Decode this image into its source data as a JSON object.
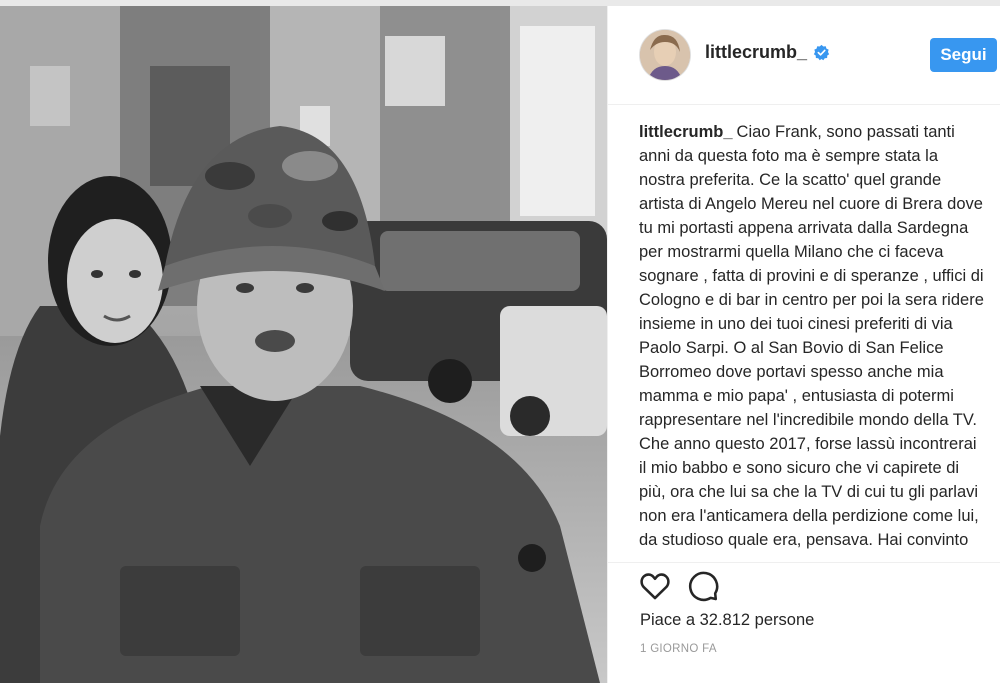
{
  "post": {
    "username": "littlecrumb_",
    "follow_label": "Segui",
    "caption_text": "Ciao Frank, sono passati tanti anni da questa foto ma è sempre stata la nostra preferita. Ce la scatto' quel grande artista di Angelo Mereu nel cuore di Brera dove tu mi portasti appena arrivata dalla Sardegna per mostrarmi quella Milano che ci faceva sognare , fatta di provini e di speranze , uffici di Cologno e di bar in centro per poi la sera ridere insieme in uno dei tuoi cinesi preferiti di via Paolo Sarpi. O al San Bovio di San Felice Borromeo dove portavi spesso anche mia mamma e mio papa' , entusiasta di potermi rappresentare nel l'incredibile mondo della TV. Che anno questo 2017, forse lassù incontrerai il mio babbo e sono sicuro che vi capirete di più, ora che lui sa che la TV di cui tu gli parlavi non era l'anticamera della perdizione come lui, da studioso quale era, pensava. Hai convinto tutti col tuo entusiasmo. hai avuto",
    "likes_label": "Piace a 32.812 persone",
    "timestamp": "1 GIORNO FA"
  },
  "icons": {
    "verified": "verified-badge-icon",
    "like": "heart-icon",
    "comment": "comment-bubble-icon"
  },
  "colors": {
    "accent": "#3897f0",
    "text": "#262626",
    "muted": "#999999"
  }
}
